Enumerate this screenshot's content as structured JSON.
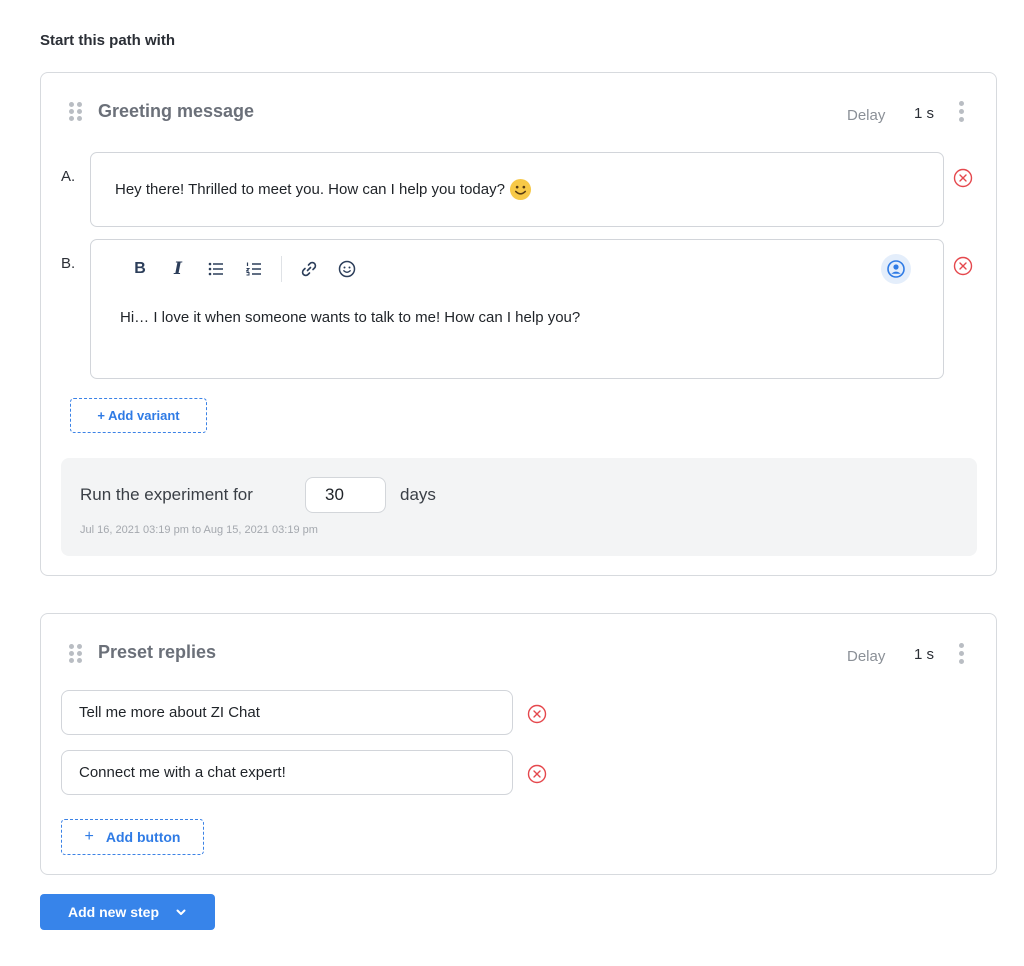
{
  "page": {
    "section_title": "Start this path with"
  },
  "greeting_card": {
    "title": "Greeting message",
    "delay_label": "Delay",
    "delay_value": "1 s",
    "variants": [
      {
        "letter": "A.",
        "text": "Hey there! Thrilled to meet you. How can I help you today?",
        "emoji_icon": "smiling-face-emoji-icon"
      },
      {
        "letter": "B.",
        "text": "Hi… I love it when someone wants to talk to me! How can I help you?"
      }
    ],
    "toolbar": {
      "bold": "B",
      "italic": "I",
      "icons": [
        "bold-icon",
        "italic-icon",
        "bulleted-list-icon",
        "numbered-list-icon",
        "link-icon",
        "emoji-icon",
        "persona-avatar-icon"
      ]
    },
    "add_variant_label": "+ Add variant",
    "experiment": {
      "label": "Run the experiment for",
      "days_value": "30",
      "unit": "days",
      "range": "Jul 16, 2021 03:19 pm to Aug 15, 2021 03:19 pm"
    }
  },
  "preset_card": {
    "title": "Preset replies",
    "delay_label": "Delay",
    "delay_value": "1 s",
    "replies": [
      "Tell me more about ZI Chat",
      "Connect me with a chat expert!"
    ],
    "add_button_plus": "+",
    "add_button_label": "Add button"
  },
  "footer": {
    "add_step_label": "Add new step",
    "dropdown_icon": "chevron-down-icon"
  },
  "colors": {
    "accent": "#3784ea",
    "danger": "#e5484d",
    "muted": "#8b9097"
  }
}
